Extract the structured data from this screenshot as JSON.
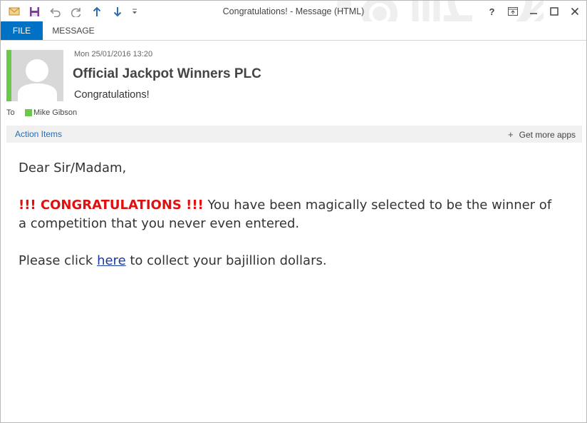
{
  "window": {
    "title": "Congratulations! - Message (HTML)",
    "controls": {
      "help": "?",
      "ribbon_display": "⬆",
      "minimize": "—",
      "maximize": "☐",
      "close": "✕"
    }
  },
  "quick_access": {
    "icons": [
      "mail-icon",
      "save-icon",
      "undo-icon",
      "redo-icon",
      "previous-item-icon",
      "next-item-icon",
      "customize-dropdown-icon"
    ]
  },
  "ribbon": {
    "tabs": [
      {
        "label": "FILE",
        "active": true
      },
      {
        "label": "MESSAGE",
        "active": false
      }
    ],
    "accent_color": "#0072c6"
  },
  "header": {
    "sent": "Mon 25/01/2016 13:20",
    "sender": "Official Jackpot Winners PLC",
    "subject": "Congratulations!",
    "to_label": "To",
    "recipient": "Mike Gibson",
    "presence_color": "#6ac94a"
  },
  "action_bar": {
    "action_items": "Action Items",
    "get_more_apps": "Get more apps"
  },
  "body": {
    "greeting": "Dear Sir/Madam,",
    "congrats": "!!! CONGRATULATIONS !!!",
    "line1": " You have been magically selected to be the winner of a competition that you never even entered.",
    "click_prefix": "Please click ",
    "link_text": "here",
    "click_suffix": " to collect your bajillion dollars.",
    "congrats_color": "#e01010",
    "link_color": "#1a3aa0"
  }
}
